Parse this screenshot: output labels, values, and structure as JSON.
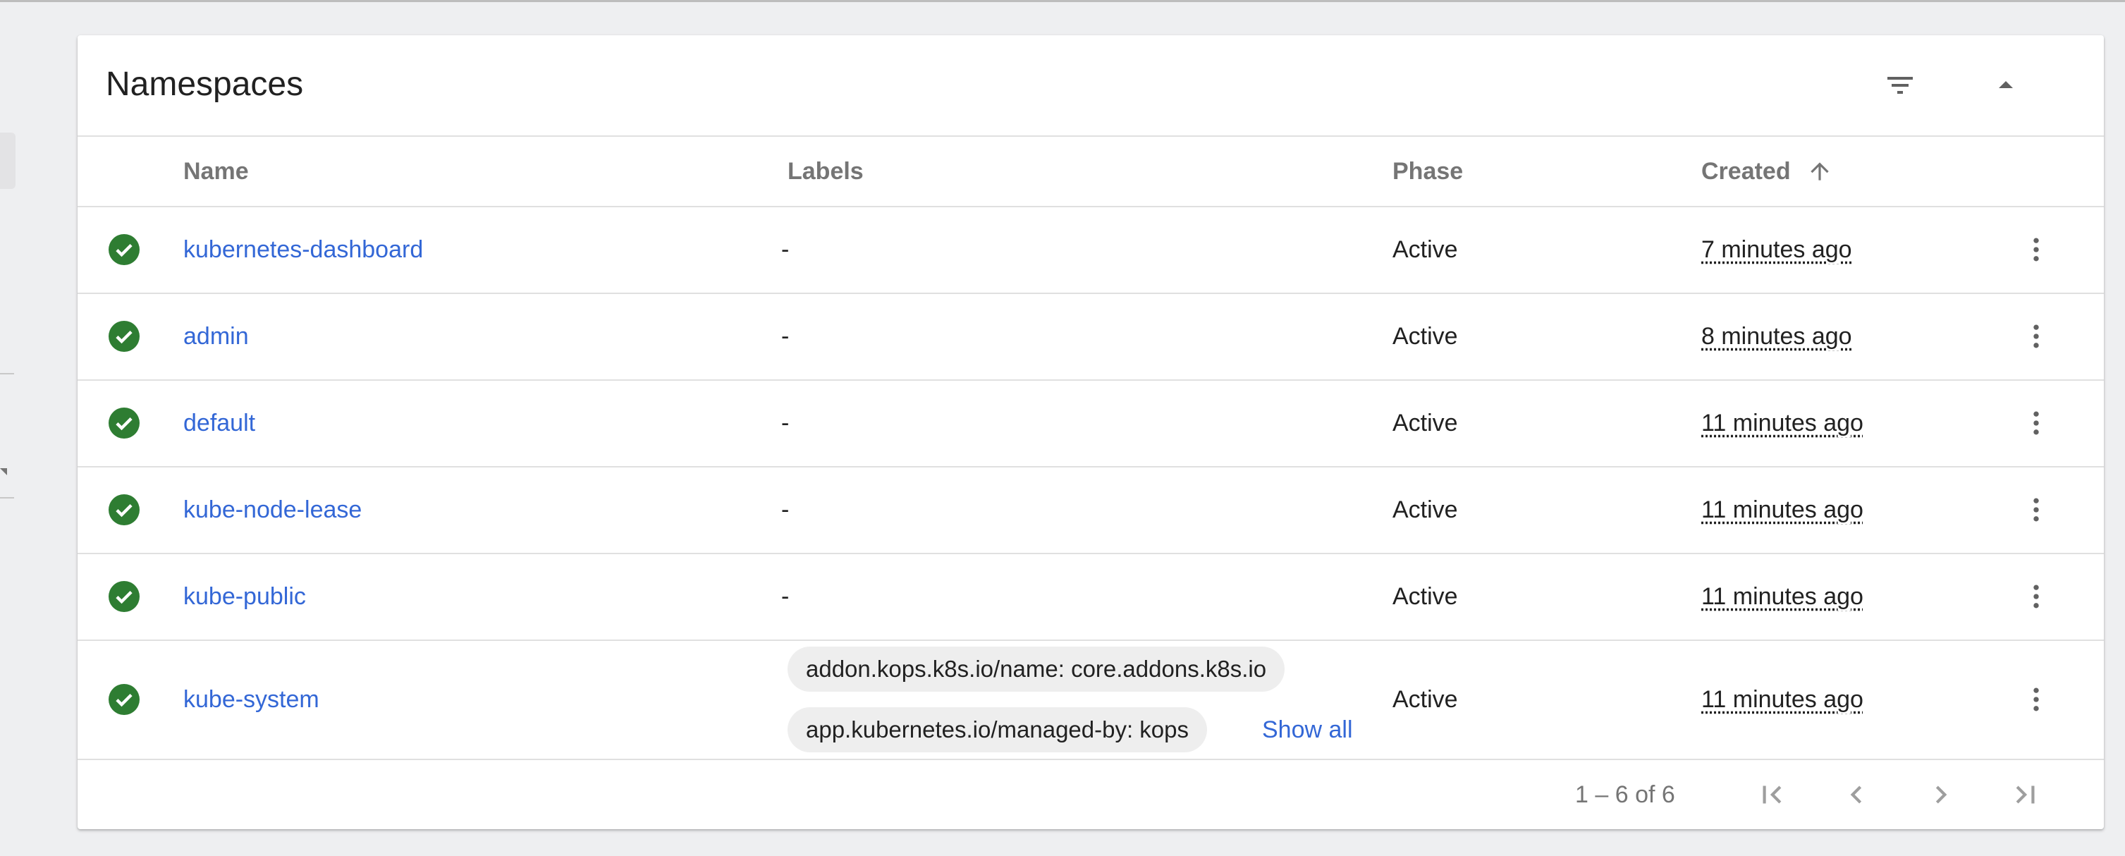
{
  "panel": {
    "title": "Namespaces",
    "filter_icon": "filter-list-icon",
    "collapse_icon": "arrow-drop-up-icon"
  },
  "table": {
    "columns": {
      "name": "Name",
      "labels": "Labels",
      "phase": "Phase",
      "created": "Created"
    },
    "sort": {
      "column": "created",
      "direction": "ascending",
      "icon": "arrow-upward-icon"
    },
    "rows": [
      {
        "name": "kubernetes-dashboard",
        "labels": "-",
        "phase": "Active",
        "created": "7 minutes ago",
        "status_icon": "check-circle-icon"
      },
      {
        "name": "admin",
        "labels": "-",
        "phase": "Active",
        "created": "8 minutes ago",
        "status_icon": "check-circle-icon"
      },
      {
        "name": "default",
        "labels": "-",
        "phase": "Active",
        "created": "11 minutes ago",
        "status_icon": "check-circle-icon"
      },
      {
        "name": "kube-node-lease",
        "labels": "-",
        "phase": "Active",
        "created": "11 minutes ago",
        "status_icon": "check-circle-icon"
      },
      {
        "name": "kube-public",
        "labels": "-",
        "phase": "Active",
        "created": "11 minutes ago",
        "status_icon": "check-circle-icon"
      },
      {
        "name": "kube-system",
        "labels": [
          "addon.kops.k8s.io/name: core.addons.k8s.io",
          "app.kubernetes.io/managed-by: kops"
        ],
        "show_all": "Show all",
        "phase": "Active",
        "created": "11 minutes ago",
        "status_icon": "check-circle-icon"
      }
    ]
  },
  "paginator": {
    "range": "1 – 6 of 6"
  },
  "colors": {
    "link": "#3367d6",
    "status_ok": "#2e7d32",
    "header_text": "#757575",
    "background": "#eeeff1"
  }
}
